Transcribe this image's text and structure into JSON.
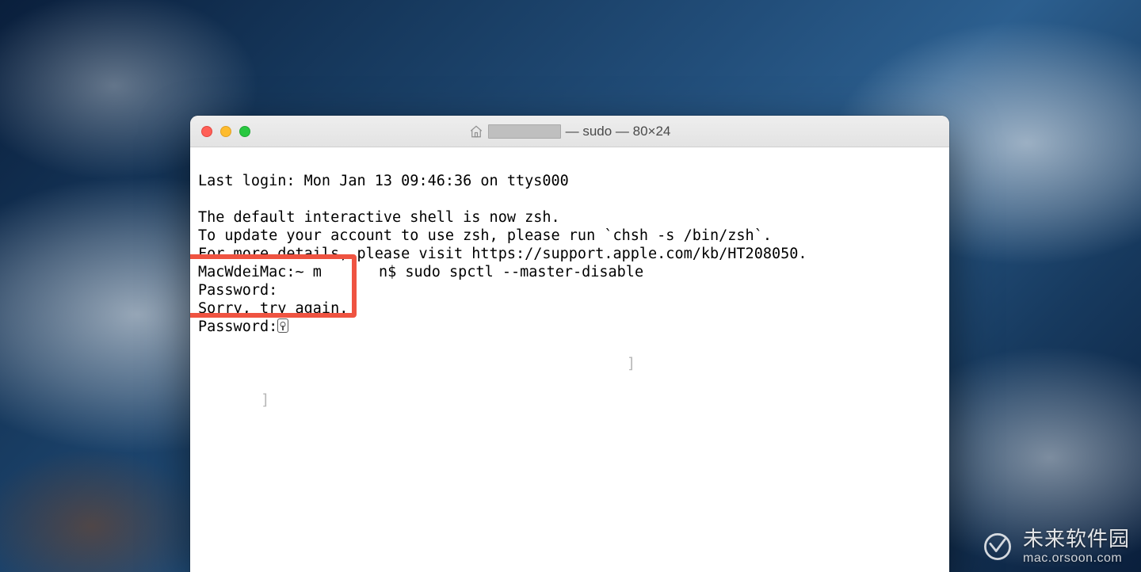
{
  "window": {
    "title_suffix": " — sudo — 80×24"
  },
  "terminal": {
    "lines": {
      "l0": "Last login: Mon Jan 13 09:46:36 on ttys000",
      "l1": "",
      "l2": "The default interactive shell is now zsh.",
      "l3": "To update your account to use zsh, please run `chsh -s /bin/zsh`.",
      "l4": "For more details, please visit https://support.apple.com/kb/HT208050.",
      "prompt_prefix": "MacWdeiMac:~ m",
      "prompt_suffix": "n$ ",
      "command": "sudo spctl --master-disable",
      "p1": "Password:",
      "p2": "Sorry, try again.",
      "p3": "Password:"
    }
  },
  "watermark": {
    "top": "未来软件园",
    "bottom": "mac.orsoon.com"
  }
}
